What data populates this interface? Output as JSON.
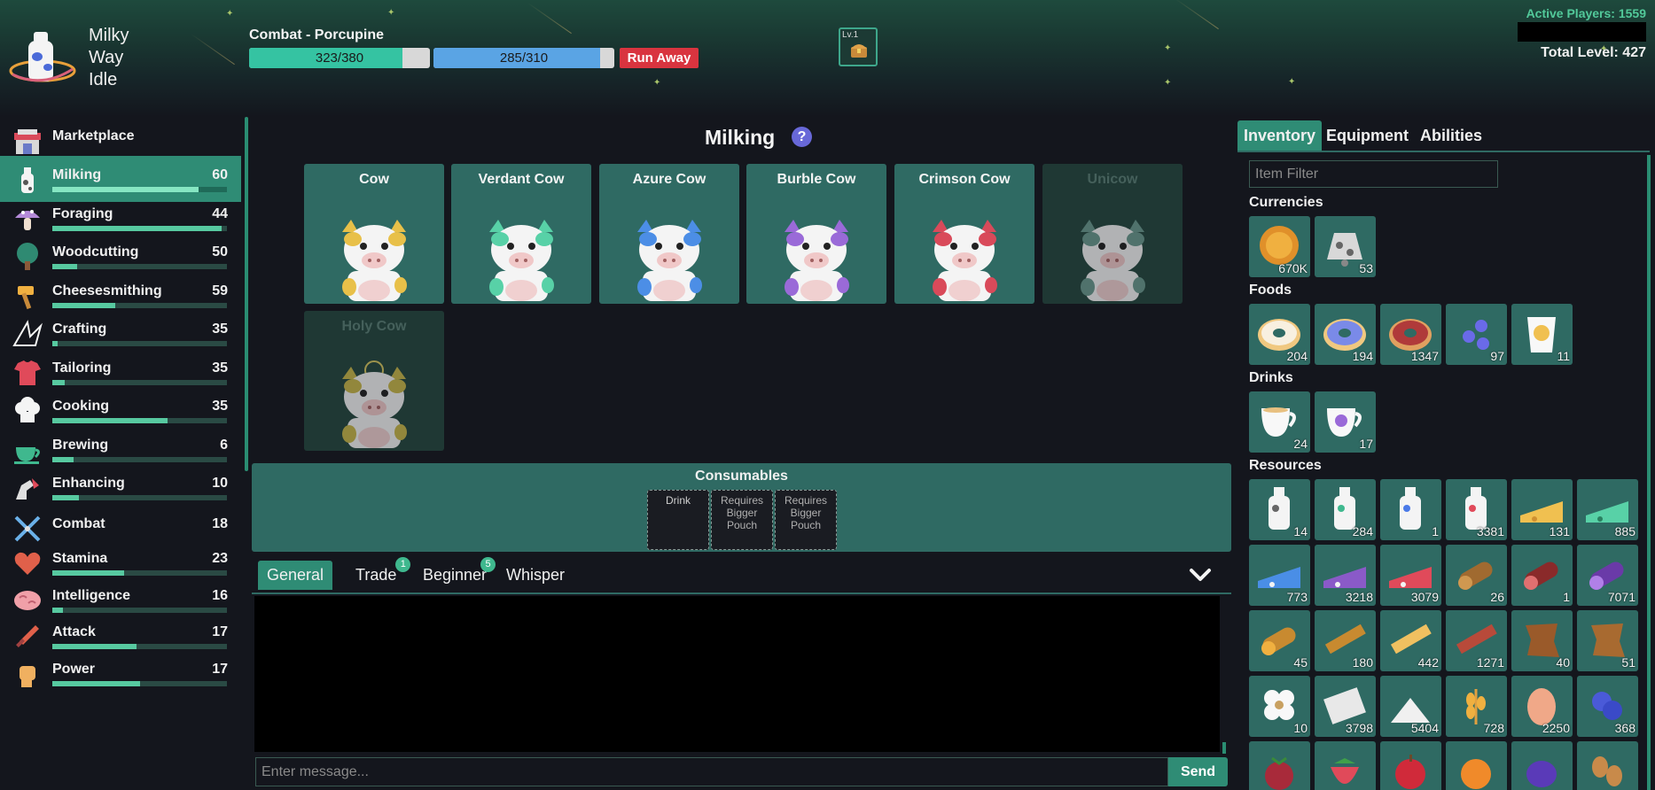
{
  "app": {
    "name_lines": [
      "Milky",
      "Way",
      "Idle"
    ],
    "active_players": "Active Players: 1559",
    "total_level": "Total Level: 427"
  },
  "combat": {
    "title": "Combat - Porcupine",
    "hp_text": "323/380",
    "hp_fraction": 0.85,
    "mp_text": "285/310",
    "mp_fraction": 0.92,
    "run_label": "Run Away",
    "chest_level": "Lv.1"
  },
  "sidebar": {
    "items": [
      {
        "label": "Marketplace",
        "level": "",
        "progress": 0,
        "icon": "market-stall-icon"
      },
      {
        "label": "Milking",
        "level": "60",
        "progress": 0.84,
        "icon": "milk-bottle-icon"
      },
      {
        "label": "Foraging",
        "level": "44",
        "progress": 0.97,
        "icon": "mushroom-icon"
      },
      {
        "label": "Woodcutting",
        "level": "50",
        "progress": 0.14,
        "icon": "tree-icon"
      },
      {
        "label": "Cheesesmithing",
        "level": "59",
        "progress": 0.36,
        "icon": "hammer-icon"
      },
      {
        "label": "Crafting",
        "level": "35",
        "progress": 0.03,
        "icon": "paper-crane-icon"
      },
      {
        "label": "Tailoring",
        "level": "35",
        "progress": 0.07,
        "icon": "shirt-icon"
      },
      {
        "label": "Cooking",
        "level": "35",
        "progress": 0.66,
        "icon": "chef-hat-icon"
      },
      {
        "label": "Brewing",
        "level": "6",
        "progress": 0.12,
        "icon": "teacup-icon"
      },
      {
        "label": "Enhancing",
        "level": "10",
        "progress": 0.15,
        "icon": "enhance-arm-icon"
      },
      {
        "label": "Combat",
        "level": "18",
        "progress": 0,
        "icon": "crossed-swords-icon"
      },
      {
        "label": "Stamina",
        "level": "23",
        "progress": 0.41,
        "icon": "heart-icon"
      },
      {
        "label": "Intelligence",
        "level": "16",
        "progress": 0.06,
        "icon": "brain-icon"
      },
      {
        "label": "Attack",
        "level": "17",
        "progress": 0.48,
        "icon": "sword-icon"
      },
      {
        "label": "Power",
        "level": "17",
        "progress": 0.5,
        "icon": "fist-icon"
      }
    ]
  },
  "main": {
    "title": "Milking",
    "help": "?",
    "actions": [
      {
        "name": "Cow",
        "color": "#e8c049",
        "locked": false
      },
      {
        "name": "Verdant Cow",
        "color": "#58d1a7",
        "locked": false
      },
      {
        "name": "Azure Cow",
        "color": "#4c8ee6",
        "locked": false
      },
      {
        "name": "Burble Cow",
        "color": "#9a6ad8",
        "locked": false
      },
      {
        "name": "Crimson Cow",
        "color": "#d94a5a",
        "locked": false
      },
      {
        "name": "Unicow",
        "color": "#6a9a8e",
        "locked": true
      },
      {
        "name": "Holy Cow",
        "color": "#c8b84a",
        "locked": true
      }
    ],
    "consumables_title": "Consumables",
    "slots": [
      "Drink",
      "Requires Bigger Pouch",
      "Requires Bigger Pouch"
    ]
  },
  "chat": {
    "tabs": [
      {
        "label": "General",
        "badge": ""
      },
      {
        "label": "Trade",
        "badge": "1"
      },
      {
        "label": "Beginner",
        "badge": "5"
      },
      {
        "label": "Whisper",
        "badge": ""
      }
    ],
    "placeholder": "Enter message...",
    "send_label": "Send"
  },
  "inventory": {
    "tabs": [
      "Inventory",
      "Equipment",
      "Abilities"
    ],
    "filter_placeholder": "Item Filter",
    "categories": [
      {
        "name": "Currencies",
        "items": [
          {
            "icon": "coin-icon",
            "count": "670K"
          },
          {
            "icon": "cow-bell-icon",
            "count": "53"
          }
        ]
      },
      {
        "name": "Foods",
        "items": [
          {
            "icon": "donut-icon",
            "count": "204"
          },
          {
            "icon": "blueberry-donut-icon",
            "count": "194"
          },
          {
            "icon": "red-donut-icon",
            "count": "1347"
          },
          {
            "icon": "gummy-icon",
            "count": "97"
          },
          {
            "icon": "yogurt-icon",
            "count": "11"
          }
        ]
      },
      {
        "name": "Drinks",
        "items": [
          {
            "icon": "milk-tea-icon",
            "count": "24"
          },
          {
            "icon": "purple-tea-icon",
            "count": "17"
          }
        ]
      },
      {
        "name": "Resources",
        "items": [
          {
            "icon": "milk-icon",
            "count": "14"
          },
          {
            "icon": "verdant-milk-icon",
            "count": "284"
          },
          {
            "icon": "azure-milk-icon",
            "count": "1"
          },
          {
            "icon": "crimson-milk-icon",
            "count": "3381"
          },
          {
            "icon": "cheese-icon",
            "count": "131"
          },
          {
            "icon": "verdant-cheese-icon",
            "count": "885"
          },
          {
            "icon": "azure-cheese-icon",
            "count": "773"
          },
          {
            "icon": "burble-cheese-icon",
            "count": "3218"
          },
          {
            "icon": "crimson-cheese-icon",
            "count": "3079"
          },
          {
            "icon": "log-icon",
            "count": "26"
          },
          {
            "icon": "birch-log-icon",
            "count": "1"
          },
          {
            "icon": "arcane-log-icon",
            "count": "7071"
          },
          {
            "icon": "cedar-log-icon",
            "count": "45"
          },
          {
            "icon": "lumber-icon",
            "count": "180"
          },
          {
            "icon": "birch-lumber-icon",
            "count": "442"
          },
          {
            "icon": "crimson-lumber-icon",
            "count": "1271"
          },
          {
            "icon": "rough-hide-icon",
            "count": "40"
          },
          {
            "icon": "reptile-hide-icon",
            "count": "51"
          },
          {
            "icon": "cotton-icon",
            "count": "10"
          },
          {
            "icon": "fabric-roll-icon",
            "count": "3798"
          },
          {
            "icon": "sugar-icon",
            "count": "5404"
          },
          {
            "icon": "wheat-icon",
            "count": "728"
          },
          {
            "icon": "egg-icon",
            "count": "2250"
          },
          {
            "icon": "blueberry-icon",
            "count": "368"
          },
          {
            "icon": "raspberry-icon",
            "count": ""
          },
          {
            "icon": "strawberry-icon",
            "count": ""
          },
          {
            "icon": "apple-icon",
            "count": ""
          },
          {
            "icon": "orange-icon",
            "count": ""
          },
          {
            "icon": "plum-icon",
            "count": ""
          },
          {
            "icon": "coffee-bean-icon",
            "count": ""
          }
        ]
      }
    ]
  }
}
